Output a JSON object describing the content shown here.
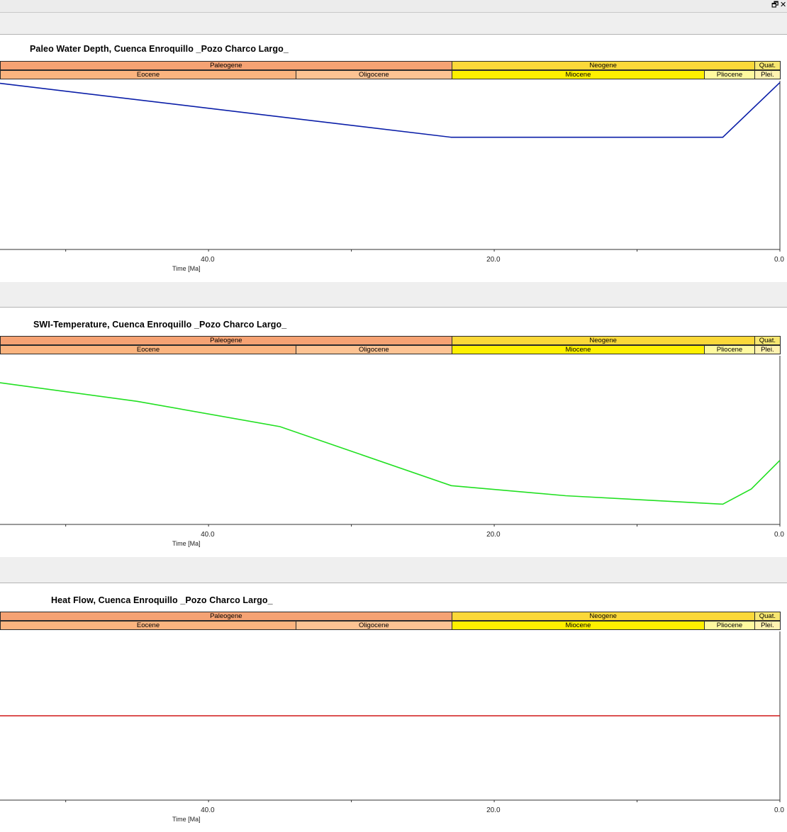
{
  "window": {
    "restore_glyph": "🗗",
    "close_glyph": "✕"
  },
  "periods": [
    {
      "name": "Paleogene",
      "from": 56,
      "to": 23,
      "color": "#f5a273"
    },
    {
      "name": "Neogene",
      "from": 23,
      "to": 1.8,
      "color": "#fbd839"
    },
    {
      "name": "Quat.",
      "from": 1.8,
      "to": 0,
      "color": "#f7e670"
    }
  ],
  "epochs": [
    {
      "name": "Eocene",
      "from": 56,
      "to": 33.9,
      "color": "#fbb47f"
    },
    {
      "name": "Oligocene",
      "from": 33.9,
      "to": 23,
      "color": "#fdc393"
    },
    {
      "name": "Miocene",
      "from": 23,
      "to": 5.3,
      "color": "#fff000"
    },
    {
      "name": "Pliocene",
      "from": 5.3,
      "to": 1.8,
      "color": "#fff99f"
    },
    {
      "name": "Plei.",
      "from": 1.8,
      "to": 0,
      "color": "#fff2b0"
    }
  ],
  "axis": {
    "ticks": [
      "40.0",
      "20.0",
      "0.0"
    ],
    "xlabel": "Time [Ma]"
  },
  "chart_data": [
    {
      "type": "line",
      "title": "Paleo Water Depth, Cuenca Enroquillo _Pozo Charco Largo_",
      "xlabel": "Time [Ma]",
      "ylabel": "",
      "xlim": [
        54.6,
        0
      ],
      "ylim": [
        0,
        1
      ],
      "color": "#0a1ea8",
      "series": [
        {
          "x": [
            54.6,
            23,
            4,
            0
          ],
          "y": [
            0.985,
            0.665,
            0.665,
            0.99
          ]
        }
      ]
    },
    {
      "type": "line",
      "title": "SWI-Temperature, Cuenca Enroquillo _Pozo Charco Largo_",
      "xlabel": "Time [Ma]",
      "ylabel": "",
      "xlim": [
        54.6,
        0
      ],
      "ylim": [
        0,
        1
      ],
      "color": "#22e022",
      "series": [
        {
          "x": [
            54.6,
            45,
            35,
            23,
            15,
            4,
            2,
            0
          ],
          "y": [
            0.84,
            0.73,
            0.58,
            0.23,
            0.17,
            0.12,
            0.21,
            0.38
          ]
        }
      ]
    },
    {
      "type": "line",
      "title": "Heat Flow, Cuenca Enroquillo _Pozo Charco Largo_",
      "xlabel": "Time [Ma]",
      "ylabel": "",
      "xlim": [
        54.6,
        0
      ],
      "ylim": [
        0,
        1
      ],
      "color": "#d01818",
      "series": [
        {
          "x": [
            54.6,
            0
          ],
          "y": [
            0.5,
            0.5
          ]
        }
      ]
    }
  ]
}
